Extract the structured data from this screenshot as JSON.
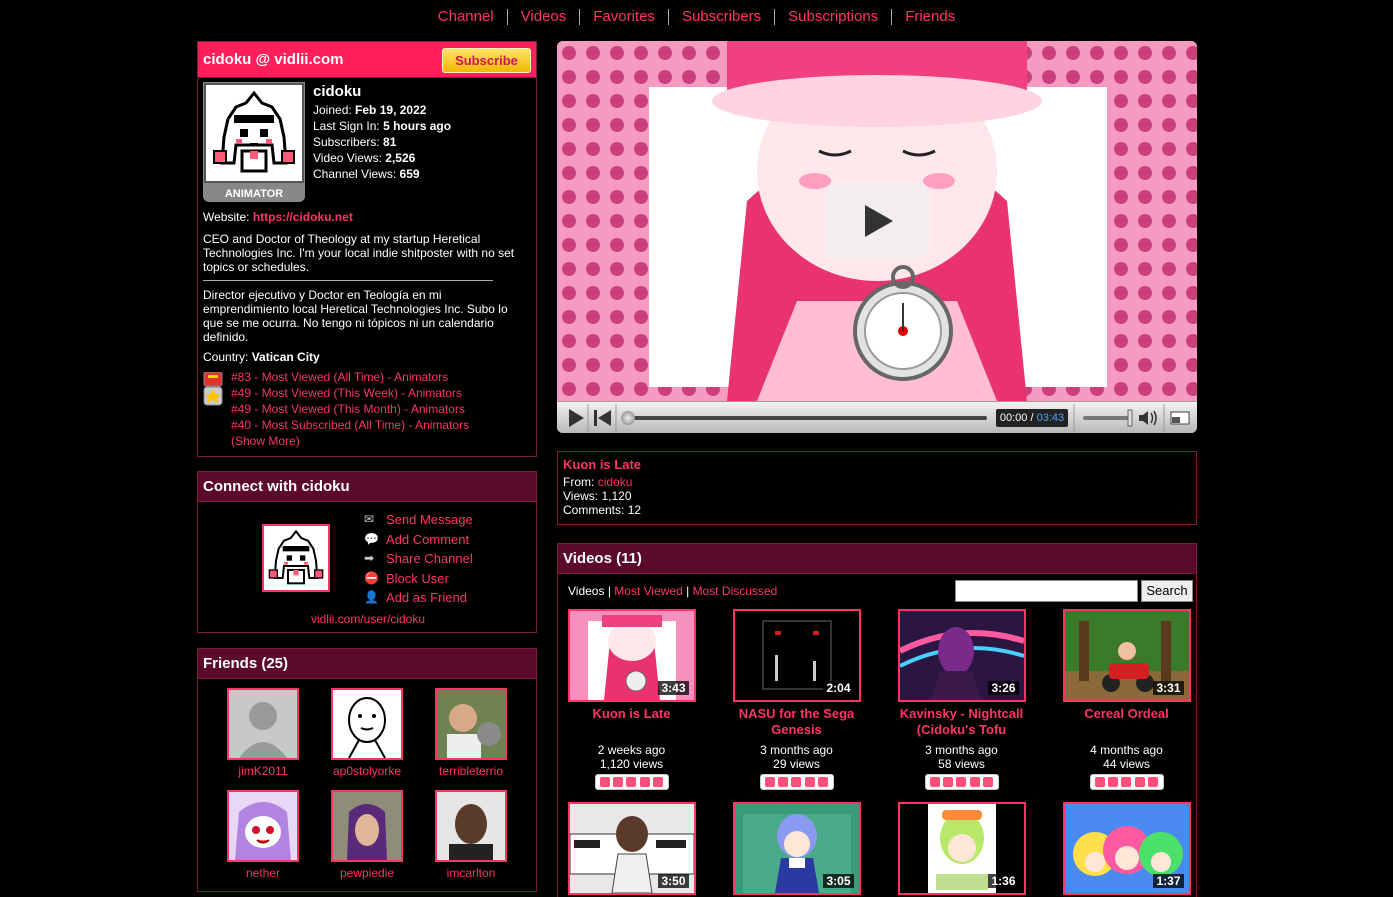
{
  "nav": [
    "Channel",
    "Videos",
    "Favorites",
    "Subscribers",
    "Subscriptions",
    "Friends"
  ],
  "profile": {
    "header": "cidoku @ vidlii.com",
    "subscribe_label": "Subscribe",
    "username": "cidoku",
    "badge": "ANIMATOR",
    "joined_label": "Joined:",
    "joined": "Feb 19, 2022",
    "last_sign_in_label": "Last Sign In:",
    "last_sign_in": "5 hours ago",
    "subscribers_label": "Subscribers:",
    "subscribers": "81",
    "video_views_label": "Video Views:",
    "video_views": "2,526",
    "channel_views_label": "Channel Views:",
    "channel_views": "659",
    "website_label": "Website:",
    "website": "https://cidoku.net",
    "bio_en": "CEO and Doctor of Theology at my startup Heretical Technologies Inc. I'm your local indie shitposter with no set topics or schedules.",
    "bio_es": "Director ejecutivo y Doctor en Teología en mi emprendimiento local Heretical Technologies Inc. Subo lo que se me ocurra. No tengo ni tópicos ni un calendario definido.",
    "country_label": "Country:",
    "country": "Vatican City",
    "honors": [
      "#83 - Most Viewed (All Time) - Animators",
      "#49 - Most Viewed (This Week) - Animators",
      "#49 - Most Viewed (This Month) - Animators",
      "#40 - Most Subscribed (All Time) - Animators"
    ],
    "show_more": "(Show More)"
  },
  "connect": {
    "header": "Connect with cidoku",
    "actions": [
      "Send Message",
      "Add Comment",
      "Share Channel",
      "Block User",
      "Add as Friend"
    ],
    "url": "vidlii.com/user/cidoku"
  },
  "friends": {
    "header": "Friends (25)",
    "list": [
      "jimK2011",
      "ap0stolyorke",
      "terribleterrio",
      "nether",
      "pewpiedie",
      "imcarlton"
    ]
  },
  "player": {
    "current_time": "00:00",
    "separator": "/",
    "duration": "03:43",
    "progress": 0
  },
  "video_info": {
    "title": "Kuon is Late",
    "from_label": "From:",
    "from": "cidoku",
    "views_label": "Views:",
    "views": "1,120",
    "comments_label": "Comments:",
    "comments": "12"
  },
  "videos": {
    "header": "Videos (11)",
    "tab_active": "Videos",
    "tabs": [
      "Most Viewed",
      "Most Discussed"
    ],
    "search_label": "Search",
    "items": [
      {
        "title": "Kuon is Late",
        "duration": "3:43",
        "age": "2 weeks ago",
        "views": "1,120 views"
      },
      {
        "title": "NASU for the Sega Genesis",
        "duration": "2:04",
        "age": "3 months ago",
        "views": "29 views"
      },
      {
        "title": "Kavinsky - Nightcall (Cidoku's Tofu",
        "duration": "3:26",
        "age": "3 months ago",
        "views": "58 views"
      },
      {
        "title": "Cereal Ordeal",
        "duration": "3:31",
        "age": "4 months ago",
        "views": "44 views"
      },
      {
        "title": "",
        "duration": "3:50",
        "age": "",
        "views": ""
      },
      {
        "title": "",
        "duration": "3:05",
        "age": "",
        "views": ""
      },
      {
        "title": "",
        "duration": "1:36",
        "age": "",
        "views": ""
      },
      {
        "title": "",
        "duration": "1:37",
        "age": "",
        "views": ""
      }
    ]
  },
  "colors": {
    "accent": "#ff3366",
    "header_bg": "#5c0a2c",
    "profile_header": "#ff1f5a"
  }
}
